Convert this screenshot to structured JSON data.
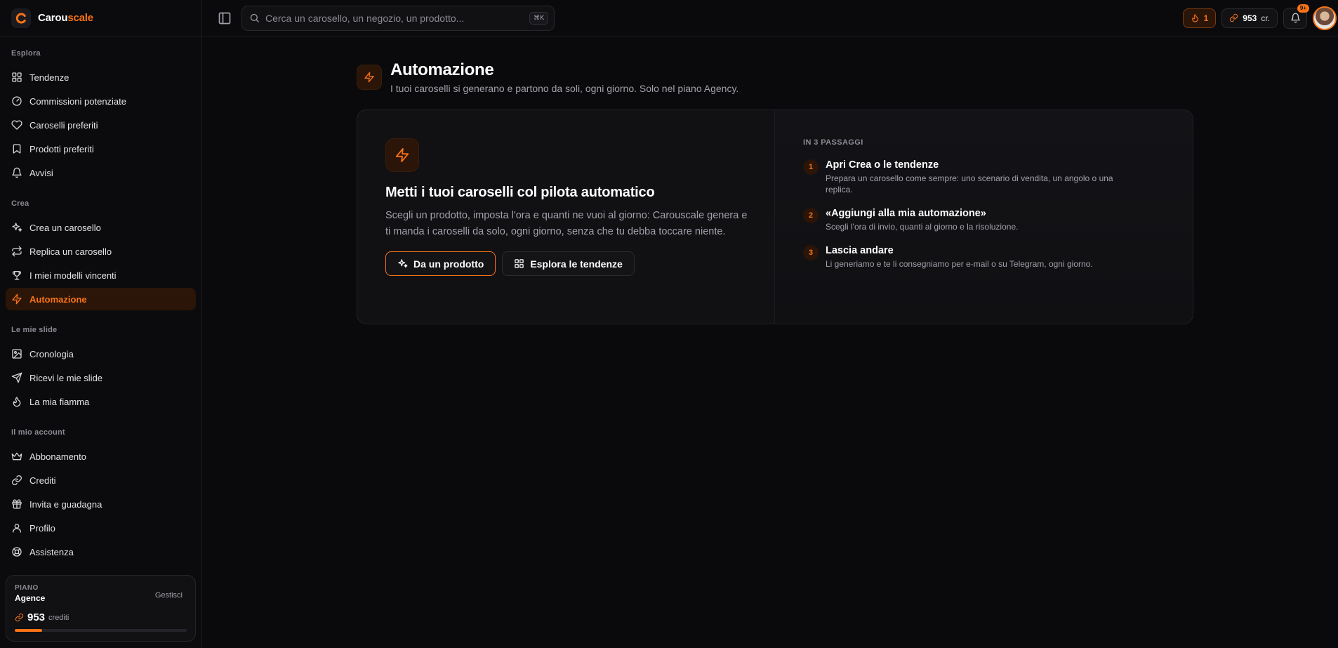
{
  "brand": {
    "name_part1": "Carou",
    "name_part2": "scale"
  },
  "search": {
    "placeholder": "Cerca un carosello, un negozio, un prodotto...",
    "shortcut": "⌘K"
  },
  "topbar": {
    "streak": "1",
    "credits": "953",
    "credits_unit": "cr.",
    "notifications_badge": "9+"
  },
  "sidebar": {
    "groups": [
      {
        "label": "Esplora",
        "items": [
          {
            "label": "Tendenze",
            "icon": "grid-icon"
          },
          {
            "label": "Commissioni potenziate",
            "icon": "gauge-icon"
          },
          {
            "label": "Caroselli preferiti",
            "icon": "heart-icon"
          },
          {
            "label": "Prodotti preferiti",
            "icon": "bookmark-icon"
          },
          {
            "label": "Avvisi",
            "icon": "bell-icon"
          }
        ]
      },
      {
        "label": "Crea",
        "items": [
          {
            "label": "Crea un carosello",
            "icon": "sparkles-icon"
          },
          {
            "label": "Replica un carosello",
            "icon": "repeat-icon"
          },
          {
            "label": "I miei modelli vincenti",
            "icon": "trophy-icon"
          },
          {
            "label": "Automazione",
            "icon": "zap-icon",
            "active": true
          }
        ]
      },
      {
        "label": "Le mie slide",
        "items": [
          {
            "label": "Cronologia",
            "icon": "image-icon"
          },
          {
            "label": "Ricevi le mie slide",
            "icon": "send-icon"
          },
          {
            "label": "La mia fiamma",
            "icon": "flame-icon"
          }
        ]
      },
      {
        "label": "Il mio account",
        "items": [
          {
            "label": "Abbonamento",
            "icon": "crown-icon"
          },
          {
            "label": "Crediti",
            "icon": "link-icon"
          },
          {
            "label": "Invita e guadagna",
            "icon": "gift-icon"
          },
          {
            "label": "Profilo",
            "icon": "user-icon"
          },
          {
            "label": "Assistenza",
            "icon": "lifebuoy-icon"
          }
        ]
      }
    ],
    "plan": {
      "label": "PIANO",
      "name": "Agence",
      "manage": "Gestisci",
      "credits": "953",
      "credits_unit": "crediti",
      "credits_fill": 0.16
    }
  },
  "page": {
    "title": "Automazione",
    "subtitle": "I tuoi caroselli si generano e partono da soli, ogni giorno. Solo nel piano Agency."
  },
  "card": {
    "title": "Metti i tuoi caroselli col pilota automatico",
    "text": "Scegli un prodotto, imposta l'ora e quanti ne vuoi al giorno: Carouscale genera e ti manda i caroselli da solo, ogni giorno, senza che tu debba toccare niente.",
    "primary_button": "Da un prodotto",
    "secondary_button": "Esplora le tendenze",
    "steps_label": "IN 3 PASSAGGI",
    "steps": [
      {
        "num": "1",
        "title": "Apri Crea o le tendenze",
        "desc": "Prepara un carosello come sempre: uno scenario di vendita, un angolo o una replica."
      },
      {
        "num": "2",
        "title": "«Aggiungi alla mia automazione»",
        "desc": "Scegli l'ora di invio, quanti al giorno e la risoluzione."
      },
      {
        "num": "3",
        "title": "Lascia andare",
        "desc": "Li generiamo e te li consegniamo per e-mail o su Telegram, ogni giorno."
      }
    ]
  },
  "colors": {
    "accent": "#f97316",
    "background": "#0a0a0c",
    "card": "#111114"
  }
}
